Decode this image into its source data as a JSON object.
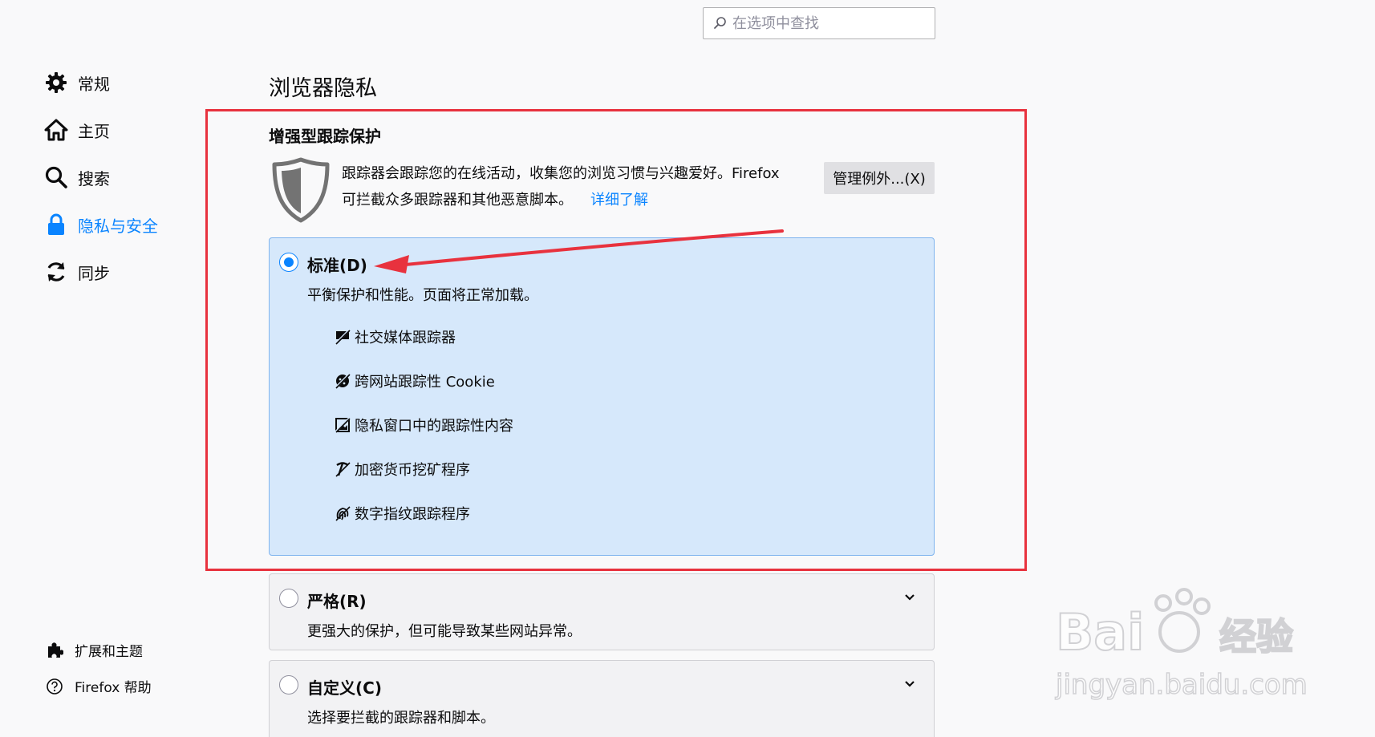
{
  "search": {
    "placeholder": "在选项中查找"
  },
  "sidebar": {
    "items": [
      {
        "label": "常规",
        "icon": "gear-icon"
      },
      {
        "label": "主页",
        "icon": "home-icon"
      },
      {
        "label": "搜索",
        "icon": "search-icon"
      },
      {
        "label": "隐私与安全",
        "icon": "lock-icon",
        "selected": true
      },
      {
        "label": "同步",
        "icon": "sync-icon"
      }
    ],
    "footer": [
      {
        "label": "扩展和主题",
        "icon": "puzzle-icon"
      },
      {
        "label": "Firefox 帮助",
        "icon": "help-icon"
      }
    ]
  },
  "main": {
    "section_title": "浏览器隐私",
    "etp": {
      "heading": "增强型跟踪保护",
      "description_line1": "跟踪器会跟踪您的在线活动，收集您的浏览习惯与兴趣爱好。Firefox",
      "description_line2": "可拦截众多跟踪器和其他恶意脚本。",
      "learn_more": "详细了解",
      "manage_button": "管理例外...(X)"
    },
    "options": [
      {
        "label": "标准(D)",
        "description": "平衡保护和性能。页面将正常加载。",
        "selected": true,
        "blocked": [
          {
            "label": "社交媒体跟踪器",
            "icon": "social-tracker-icon"
          },
          {
            "label": "跨网站跟踪性 Cookie",
            "icon": "cookie-icon"
          },
          {
            "label": "隐私窗口中的跟踪性内容",
            "icon": "tracking-content-icon"
          },
          {
            "label": "加密货币挖矿程序",
            "icon": "cryptominer-icon"
          },
          {
            "label": "数字指纹跟踪程序",
            "icon": "fingerprinter-icon"
          }
        ]
      },
      {
        "label": "严格(R)",
        "description": "更强大的保护，但可能导致某些网站异常。",
        "selected": false
      },
      {
        "label": "自定义(C)",
        "description": "选择要拦截的跟踪器和脚本。",
        "selected": false
      }
    ]
  },
  "colors": {
    "accent": "#0a84ff",
    "annotation": "#e8323e",
    "selected_bg": "#d6e8fb"
  }
}
